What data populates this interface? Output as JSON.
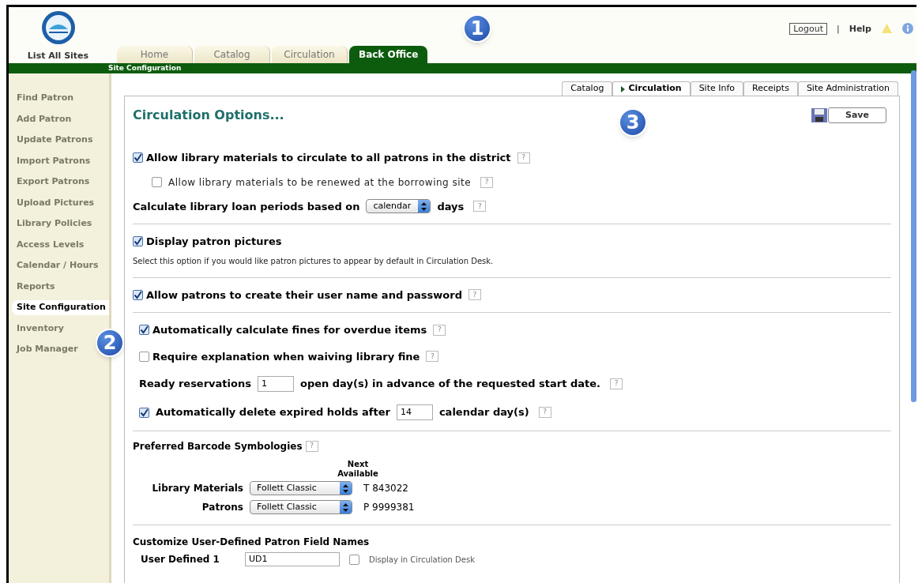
{
  "header": {
    "site_link": "List All Sites",
    "tabs": [
      {
        "label": "Home",
        "selected": false
      },
      {
        "label": "Catalog",
        "selected": false
      },
      {
        "label": "Circulation",
        "selected": false
      },
      {
        "label": "Back Office",
        "selected": true
      }
    ],
    "logout": "Logout",
    "separator": "|",
    "help": "Help",
    "subnav": "Site Configuration"
  },
  "sidebar": {
    "items": [
      {
        "label": "Find Patron",
        "selected": false
      },
      {
        "label": "Add Patron",
        "selected": false
      },
      {
        "label": "Update Patrons",
        "selected": false
      },
      {
        "label": "Import Patrons",
        "selected": false
      },
      {
        "label": "Export Patrons",
        "selected": false
      },
      {
        "label": "Upload Pictures",
        "selected": false
      },
      {
        "label": "Library Policies",
        "selected": false
      },
      {
        "label": "Access Levels",
        "selected": false
      },
      {
        "label": "Calendar / Hours",
        "selected": false
      },
      {
        "label": "Reports",
        "selected": false
      },
      {
        "label": "Site Configuration",
        "selected": true
      },
      {
        "label": "Inventory",
        "selected": false
      },
      {
        "label": "Job Manager",
        "selected": false
      }
    ]
  },
  "callouts": [
    "1",
    "2",
    "3"
  ],
  "content": {
    "tabs": [
      {
        "label": "Catalog",
        "selected": false
      },
      {
        "label": "Circulation",
        "selected": true
      },
      {
        "label": "Site Info",
        "selected": false
      },
      {
        "label": "Receipts",
        "selected": false
      },
      {
        "label": "Site Administration",
        "selected": false
      }
    ],
    "title": "Circulation Options...",
    "save_button": "Save",
    "sections": [
      {
        "rows": [
          {
            "kind": "checkbox",
            "label": "Allow library materials to circulate to all patrons in the district",
            "checked": true,
            "help": "?"
          },
          {
            "kind": "sub_checkbox",
            "label": "Allow library materials to be renewed at the borrowing site",
            "checked": false,
            "help": "?"
          },
          {
            "kind": "select",
            "before": "Calculate library loan periods based on",
            "value": "calendar",
            "after": "days",
            "help": "?"
          }
        ]
      },
      {
        "rows": [
          {
            "kind": "checkbox",
            "label": "Display patron pictures",
            "checked": true
          },
          {
            "kind": "note",
            "text": "Select this option if you would like patron pictures to appear by default in Circulation Desk."
          }
        ]
      },
      {
        "rows": [
          {
            "kind": "checkbox",
            "label": "Allow patrons to create their user name and password",
            "checked": true,
            "help": "?"
          }
        ]
      },
      {
        "rows": [
          {
            "kind": "checkbox",
            "label": "Automatically calculate fines for overdue items",
            "checked": true,
            "help": "?"
          },
          {
            "kind": "checkbox",
            "label": "Require explanation when waiving library fine",
            "checked": false,
            "help": "?"
          },
          {
            "kind": "input",
            "before": "Ready reservations",
            "value": "1",
            "after": "open day(s) in advance of the requested start date.",
            "help": "?"
          },
          {
            "kind": "checkbox_input",
            "checked": true,
            "before": "Automatically delete expired holds after",
            "value": "14",
            "after": "calendar day(s)",
            "help": "?"
          }
        ]
      }
    ],
    "barcodes": {
      "title": "Preferred Barcode Symbologies",
      "help": "?",
      "next_header": "Next Available",
      "rows": [
        {
          "label": "Library Materials",
          "value": "Follett Classic",
          "next": "T 843022"
        },
        {
          "label": "Patrons",
          "value": "Follett Classic",
          "next": "P 9999381"
        }
      ]
    },
    "custom_fields": {
      "title": "Customize User-Defined Patron Field Names",
      "rows": [
        {
          "label": "User Defined 1",
          "value": "UD1",
          "display_label": "Display in Circulation Desk",
          "display_checked": false
        }
      ]
    }
  }
}
